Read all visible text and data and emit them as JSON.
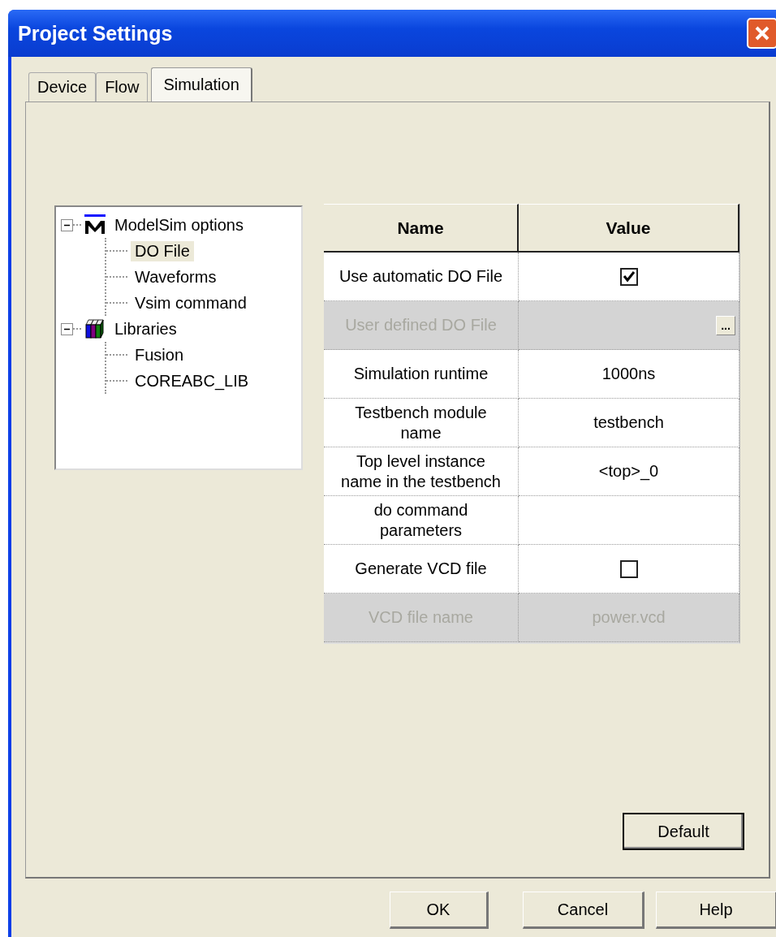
{
  "window": {
    "title": "Project Settings"
  },
  "tabs": [
    {
      "label": "Device",
      "selected": false
    },
    {
      "label": "Flow",
      "selected": false
    },
    {
      "label": "Simulation",
      "selected": true
    }
  ],
  "tree": [
    {
      "label": "ModelSim options",
      "kind": "modelsim",
      "expanded": true,
      "selected": false,
      "children": [
        {
          "label": "DO File",
          "selected": true
        },
        {
          "label": "Waveforms",
          "selected": false
        },
        {
          "label": "Vsim command",
          "selected": false
        }
      ]
    },
    {
      "label": "Libraries",
      "kind": "books",
      "expanded": true,
      "selected": false,
      "children": [
        {
          "label": "Fusion",
          "selected": false
        },
        {
          "label": "COREABC_LIB",
          "selected": false
        }
      ]
    }
  ],
  "table": {
    "columns": [
      "Name",
      "Value"
    ],
    "rows": [
      {
        "name": "Use automatic DO File",
        "kind": "checkbox",
        "checked": true,
        "disabled": false
      },
      {
        "name": "User defined DO File",
        "kind": "browse",
        "browse_label": "...",
        "disabled": true
      },
      {
        "name": "Simulation runtime",
        "kind": "text",
        "value": "1000ns",
        "disabled": false
      },
      {
        "name": "Testbench module name",
        "kind": "text",
        "value": "testbench",
        "disabled": false
      },
      {
        "name": "Top level instance name in the testbench",
        "kind": "text",
        "value": "<top>_0",
        "disabled": false
      },
      {
        "name": "do command parameters",
        "kind": "text",
        "disabled": false
      },
      {
        "name": "Generate VCD file",
        "kind": "checkbox",
        "checked": false,
        "disabled": false
      },
      {
        "name": "VCD file name",
        "kind": "text",
        "value": "power.vcd",
        "disabled": true
      }
    ]
  },
  "default_button": "Default",
  "buttons": [
    "OK",
    "Cancel",
    "Help"
  ]
}
